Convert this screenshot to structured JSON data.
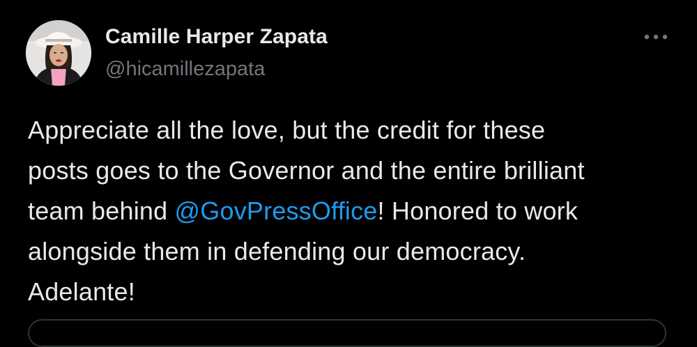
{
  "author": {
    "display_name": "Camille Harper Zapata",
    "handle": "@hicamillezapata",
    "avatar_icon": "profile-photo-icon"
  },
  "menu": {
    "more_icon": "more-horizontal-icon"
  },
  "tweet": {
    "line1": "Appreciate all the love, but the credit for these",
    "line2": "posts goes to the Governor and the entire brilliant",
    "line3_before": "team behind ",
    "line3_mention": "@GovPressOffice",
    "line3_after": "! Honored to work",
    "line4": "alongside them in defending our democracy.",
    "line5": "Adelante!"
  },
  "colors": {
    "background": "#000000",
    "text": "#e7e9ea",
    "secondary": "#71767b",
    "link": "#1d9bf0"
  }
}
